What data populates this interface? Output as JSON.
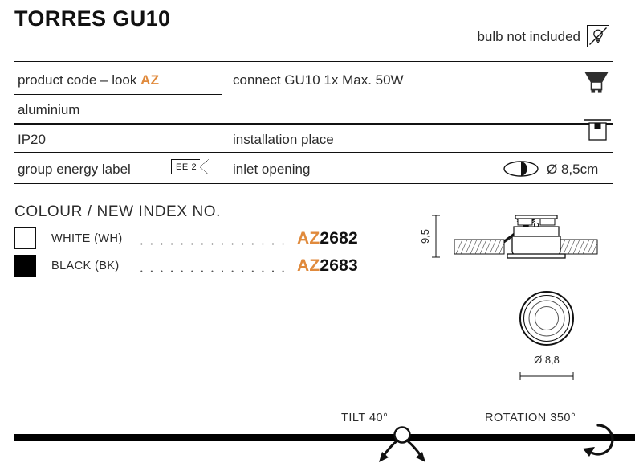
{
  "header": {
    "title": "TORRES GU10",
    "bulb_note": "bulb not included",
    "bulb_icon": "bulb-not-included-icon"
  },
  "spec_table": {
    "left_column": [
      {
        "label": "product code – look ",
        "accent": "AZ"
      },
      {
        "label": "aluminium",
        "accent": ""
      },
      {
        "label": "IP20",
        "accent": ""
      },
      {
        "label": "group energy label",
        "accent": "",
        "badge": "EE 2"
      }
    ],
    "right_column": [
      {
        "label": "connect GU10 1x Max. 50W",
        "icon": "gu10-lamp-icon",
        "value": ""
      },
      {
        "label": "installation place",
        "icon": "recessed-ceiling-icon",
        "value": ""
      },
      {
        "label": "inlet opening",
        "icon": "inlet-opening-icon",
        "value": "Ø 8,5cm"
      }
    ]
  },
  "colour_section": {
    "heading": "COLOUR / NEW INDEX NO.",
    "rows": [
      {
        "swatch": "white",
        "name": "WHITE (WH)",
        "prefix": "AZ",
        "number": "2682"
      },
      {
        "swatch": "black",
        "name": "BLACK (BK)",
        "prefix": "AZ",
        "number": "2683"
      }
    ]
  },
  "drawings": {
    "side_view": {
      "name": "recessed-spotlight-side-view",
      "height_dim": "9,5"
    },
    "front_view": {
      "name": "recessed-spotlight-front-view",
      "diameter_dim": "Ø 8,8"
    }
  },
  "bottom_bar": {
    "tilt": "TILT 40°",
    "rotation": "ROTATION 350°"
  },
  "colors": {
    "accent": "#E08A3C",
    "text": "#2b2b2b",
    "line": "#111111"
  }
}
